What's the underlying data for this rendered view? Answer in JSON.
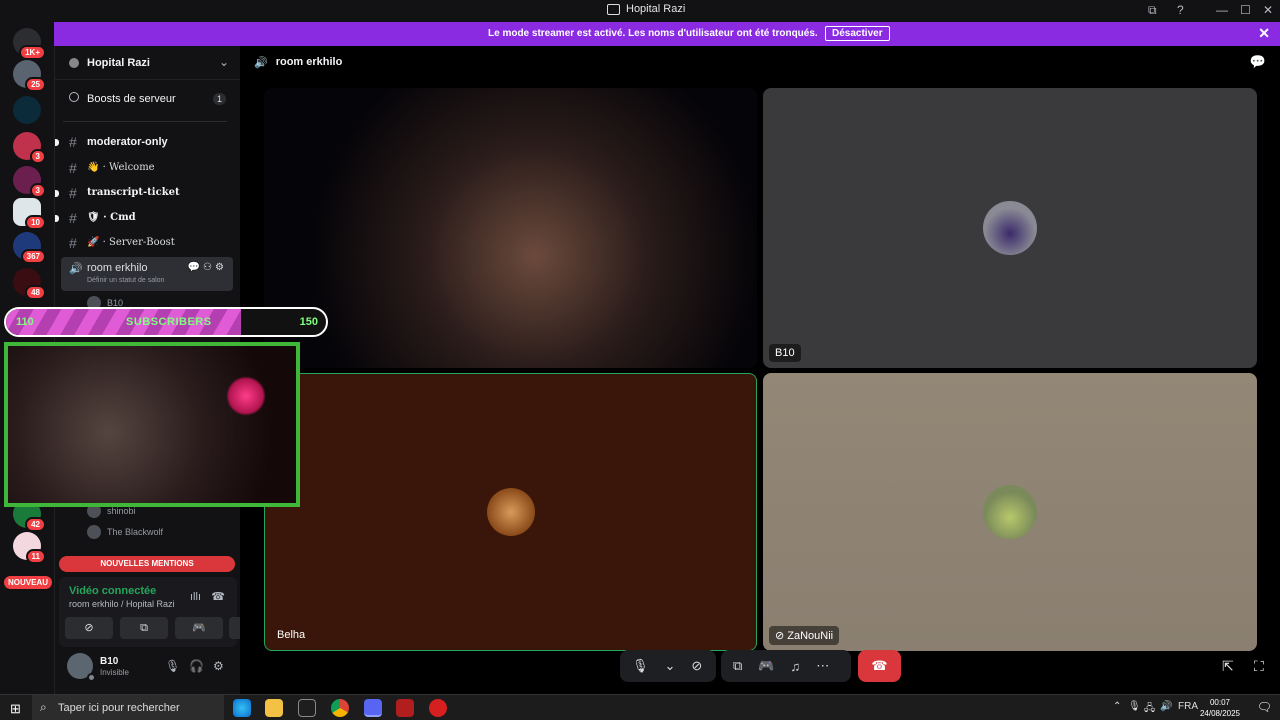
{
  "window": {
    "title": "Hopital Razi",
    "buttons": [
      "⧉",
      "?",
      "—",
      "☐",
      "✕"
    ]
  },
  "banner": {
    "text": "Le mode streamer est activé. Les noms d'utilisateur ont été tronqués.",
    "button": "Désactiver",
    "close": "✕"
  },
  "rail": {
    "badges": [
      "1K+",
      "25",
      "3",
      "3",
      "10",
      "367",
      "48",
      "42",
      "11"
    ],
    "nouveau": "NOUVEAU"
  },
  "sidebar": {
    "guild_name": "Hopital Razi",
    "boosts_label": "Boosts de serveur",
    "boosts_count": "1",
    "channels": [
      {
        "name": "moderator-only"
      },
      {
        "name": "👋 · Welcome"
      },
      {
        "name": "transcript-ticket"
      },
      {
        "name": "🛡 · Cmd"
      },
      {
        "name": "🚀 · Server-Boost"
      }
    ],
    "active_channel": "room erkhilo",
    "channel_status": "Définir un statut de salon",
    "voice_users": [
      "B10",
      "shinobi",
      "The Blackwolf"
    ],
    "mentions": "NOUVELLES MENTIONS"
  },
  "voice_panel": {
    "status": "Vidéo connectée",
    "room": "room erkhilo / Hopital Razi"
  },
  "user": {
    "name": "B10",
    "status": "Invisible"
  },
  "main": {
    "room_title": "room erkhilo",
    "tiles": [
      {
        "label": "B10"
      },
      {
        "label": "Belha"
      },
      {
        "label": "ZaNouNii"
      }
    ],
    "tile1_partial_label": "a"
  },
  "overlay": {
    "sub_current": "110",
    "sub_text": "SUBSCRIBERS",
    "sub_goal": "150",
    "sub_progress_fraction": 0.733
  },
  "taskbar": {
    "search_placeholder": "Taper ici pour rechercher",
    "lang": "FRA",
    "time": "00:07",
    "date": "24/08/2025"
  }
}
